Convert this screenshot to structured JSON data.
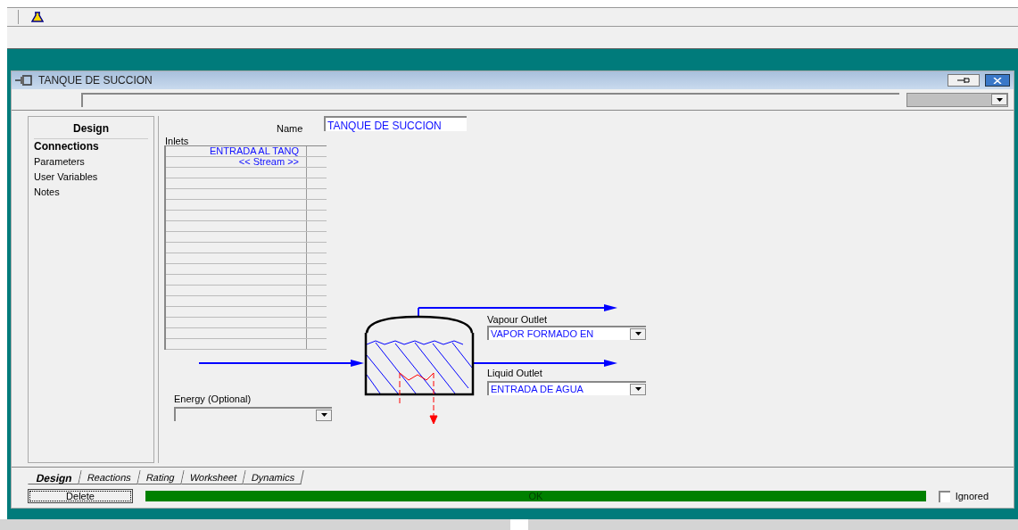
{
  "window": {
    "title": "TANQUE DE SUCCION"
  },
  "design_nav": {
    "heading": "Design",
    "items": [
      {
        "label": "Connections",
        "selected": true
      },
      {
        "label": "Parameters",
        "selected": false
      },
      {
        "label": "User Variables",
        "selected": false
      },
      {
        "label": "Notes",
        "selected": false
      }
    ]
  },
  "name_field": {
    "label": "Name",
    "value": "TANQUE DE SUCCION"
  },
  "inlets": {
    "label": "Inlets",
    "rows": [
      "ENTRADA AL TANQ",
      "<< Stream >>"
    ]
  },
  "vapour_outlet": {
    "label": "Vapour Outlet",
    "value": "VAPOR FORMADO EN"
  },
  "liquid_outlet": {
    "label": "Liquid Outlet",
    "value": "ENTRADA DE AGUA"
  },
  "energy": {
    "label": "Energy (Optional)"
  },
  "tabs": [
    {
      "label": "Design",
      "selected": true
    },
    {
      "label": "Reactions",
      "selected": false
    },
    {
      "label": "Rating",
      "selected": false
    },
    {
      "label": "Worksheet",
      "selected": false
    },
    {
      "label": "Dynamics",
      "selected": false
    }
  ],
  "status_bar": {
    "delete_button": "Delete",
    "status": "OK",
    "ignored": {
      "label": "Ignored",
      "checked": false
    }
  }
}
